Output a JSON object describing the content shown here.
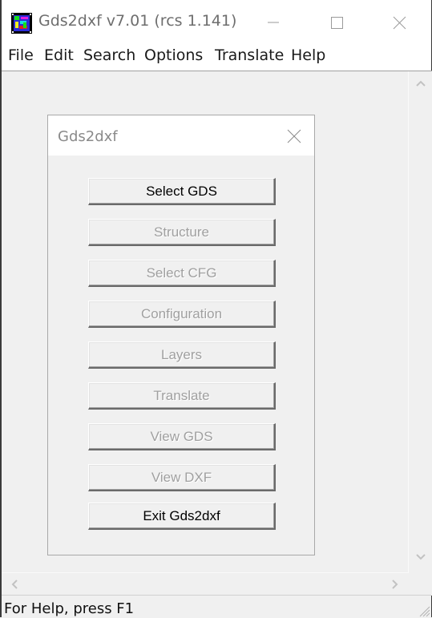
{
  "window": {
    "title": "Gds2dxf v7.01 (rcs 1.141)",
    "icon": "app-icon",
    "controls": [
      "minimize-icon",
      "maximize-icon",
      "close-icon"
    ]
  },
  "menubar": {
    "items": [
      {
        "label": "File"
      },
      {
        "label": "Edit"
      },
      {
        "label": "Search"
      },
      {
        "label": "Options"
      },
      {
        "label": "Translate"
      },
      {
        "label": "Help"
      }
    ]
  },
  "dialog": {
    "title": "Gds2dxf",
    "buttons": [
      {
        "label": "Select GDS",
        "enabled": true
      },
      {
        "label": "Structure",
        "enabled": false
      },
      {
        "label": "Select CFG",
        "enabled": false
      },
      {
        "label": "Configuration",
        "enabled": false
      },
      {
        "label": "Layers",
        "enabled": false
      },
      {
        "label": "Translate",
        "enabled": false
      },
      {
        "label": "View GDS",
        "enabled": false
      },
      {
        "label": "View DXF",
        "enabled": false
      },
      {
        "label": "Exit Gds2dxf",
        "enabled": true
      }
    ]
  },
  "statusbar": {
    "text": "For Help, press F1"
  },
  "colors": {
    "enabled_text": "#000000",
    "disabled_text": "#a0a0a0",
    "background": "#f0f0f0"
  }
}
